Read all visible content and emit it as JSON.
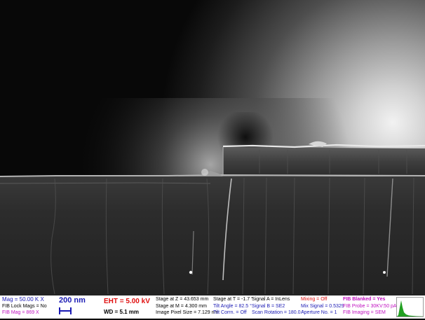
{
  "colors": {
    "blue": "#1a1ab4",
    "red": "#e01010",
    "magenta": "#c010c0",
    "black": "#000000",
    "histogram": "#22a022"
  },
  "info_bar": {
    "mag": "Mag =  50.00 K X",
    "fib_lock_mags": "FIB Lock Mags = No",
    "fib_mag": "FIB Mag =   869 X",
    "scale_bar": "200 nm",
    "eht": "EHT =  5.00 kV",
    "wd": "WD =  5.1 mm",
    "stage_z": "Stage at Z = 43.653 mm",
    "stage_m": "Stage at M =  4.300 mm",
    "pixel_size": "Image Pixel Size = 7.129 nm",
    "stage_t": "Stage at T =  -1.7 °",
    "tilt_angle": "Tilt Angle =  82.5 °",
    "tilt_corrn": "Tilt Corrn. = Off",
    "signal_a": "Signal A = InLens",
    "signal_b": "Signal B = SE2",
    "scan_rotation": "Scan Rotation = 180.0 °",
    "mixing": "Mixing = Off",
    "mix_signal": "Mix Signal = 0.5329",
    "aperture": "Aperture No. = 1",
    "fib_blanked": "FIB Blanked = Yes",
    "fib_probe": "FIB Probe = 30KV:50 pA",
    "fib_imaging": "FIB Imaging = SEM"
  }
}
